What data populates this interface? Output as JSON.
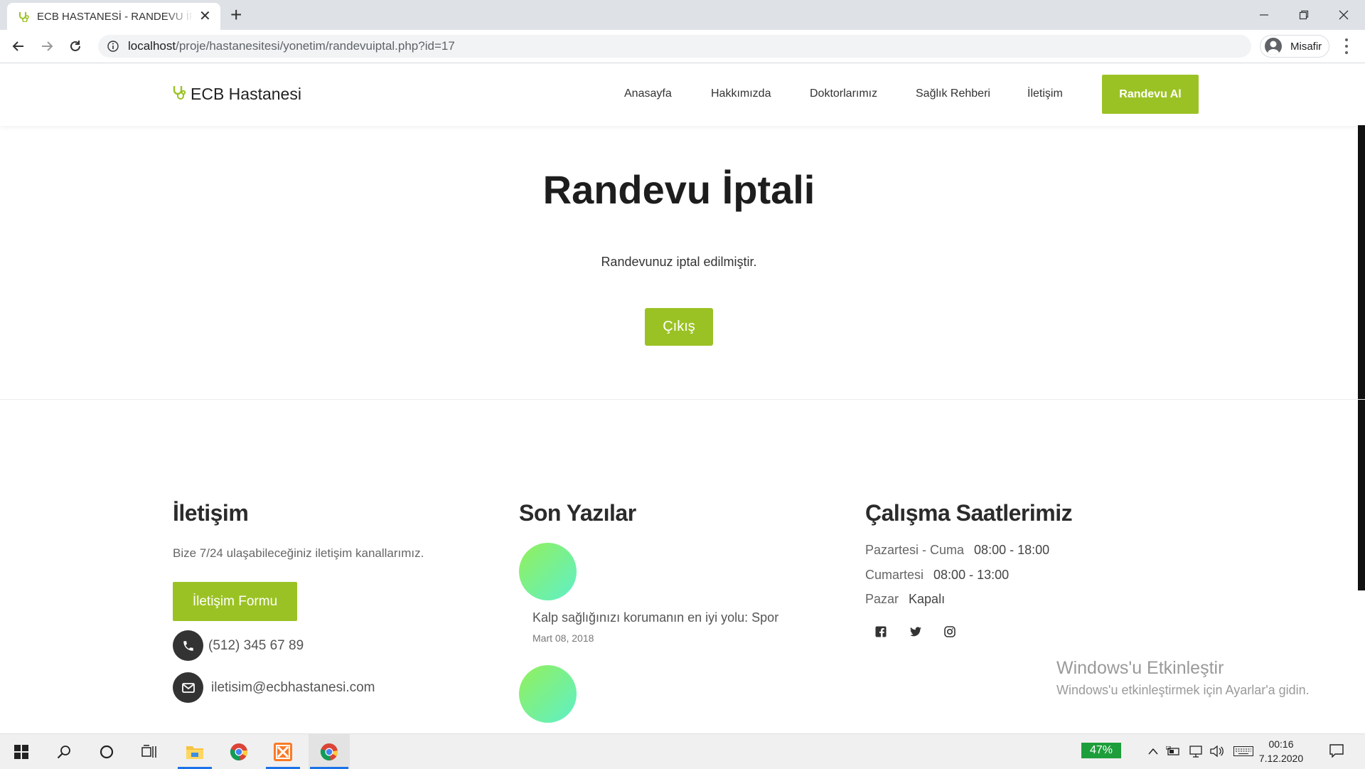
{
  "browser": {
    "tab_title": "ECB HASTANESİ - RANDEVU İPTALİ",
    "url_host": "localhost",
    "url_path": "/proje/hastanesitesi/yonetim/randevuiptal.php?id=17",
    "profile_label": "Misafir"
  },
  "site": {
    "brand": "ECB Hastanesi",
    "nav": [
      "Anasayfa",
      "Hakkımızda",
      "Doktorlarımız",
      "Sağlık Rehberi",
      "İletişim"
    ],
    "cta": "Randevu Al",
    "accent_color": "#9bc224"
  },
  "main": {
    "title": "Randevu İptali",
    "message": "Randevunuz iptal edilmiştir.",
    "exit_label": "Çıkış"
  },
  "footer": {
    "contact": {
      "heading": "İletişim",
      "text": "Bize 7/24 ulaşabileceğiniz iletişim kanallarımız.",
      "form_button": "İletişim Formu",
      "phone": "(512) 345 67 89",
      "email": "iletisim@ecbhastanesi.com"
    },
    "posts": {
      "heading": "Son Yazılar",
      "items": [
        {
          "title": "Kalp sağlığınızı korumanın en iyi yolu: Spor",
          "date": "Mart 08, 2018"
        }
      ]
    },
    "hours": {
      "heading": "Çalışma Saatlerimiz",
      "rows": [
        {
          "day": "Pazartesi - Cuma",
          "time": "08:00 - 18:00"
        },
        {
          "day": "Cumartesi",
          "time": "08:00 - 13:00"
        },
        {
          "day": "Pazar",
          "time": "Kapalı"
        }
      ],
      "social": [
        "facebook-icon",
        "twitter-icon",
        "instagram-icon"
      ]
    }
  },
  "watermark": {
    "line1": "Windows'u Etkinleştir",
    "line2": "Windows'u etkinleştirmek için Ayarlar'a gidin."
  },
  "taskbar": {
    "battery": "47%",
    "time": "00:16",
    "date": "7.12.2020"
  }
}
